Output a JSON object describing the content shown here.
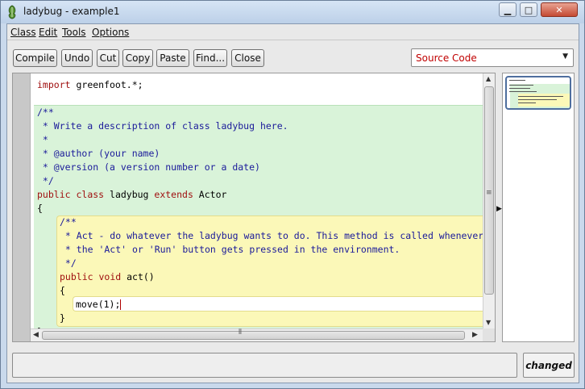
{
  "window": {
    "title": "ladybug - example1"
  },
  "menubar": {
    "items": [
      {
        "label": "Class"
      },
      {
        "label": "Edit"
      },
      {
        "label": "Tools"
      },
      {
        "label": "Options"
      }
    ]
  },
  "toolbar": {
    "buttons": [
      {
        "label": "Compile"
      },
      {
        "label": "Undo"
      },
      {
        "label": "Cut"
      },
      {
        "label": "Copy"
      },
      {
        "label": "Paste"
      },
      {
        "label": "Find..."
      },
      {
        "label": "Close"
      }
    ],
    "view_select": {
      "selected": "Source Code"
    }
  },
  "editor": {
    "lines": [
      {
        "parts": [
          {
            "t": "import ",
            "c": "kw"
          },
          {
            "t": "greenfoot.*;",
            "c": "tx"
          }
        ]
      },
      {
        "parts": [
          {
            "t": "/**",
            "c": "cm"
          }
        ]
      },
      {
        "parts": [
          {
            "t": " * Write a description of class ladybug here.",
            "c": "cm"
          }
        ]
      },
      {
        "parts": [
          {
            "t": " *",
            "c": "cm"
          }
        ]
      },
      {
        "parts": [
          {
            "t": " * @author (your name)",
            "c": "cm"
          }
        ]
      },
      {
        "parts": [
          {
            "t": " * @version (a version number or a date)",
            "c": "cm"
          }
        ]
      },
      {
        "parts": [
          {
            "t": " */",
            "c": "cm"
          }
        ]
      },
      {
        "parts": [
          {
            "t": "public ",
            "c": "kw"
          },
          {
            "t": "class ",
            "c": "kw"
          },
          {
            "t": "ladybug ",
            "c": "tx"
          },
          {
            "t": "extends ",
            "c": "kw"
          },
          {
            "t": "Actor",
            "c": "tx"
          }
        ]
      },
      {
        "parts": [
          {
            "t": "{",
            "c": "tx"
          }
        ]
      },
      {
        "parts": [
          {
            "t": "/**",
            "c": "cm"
          }
        ]
      },
      {
        "parts": [
          {
            "t": " * Act - do whatever the ladybug wants to do. This method is called whenever",
            "c": "cm"
          }
        ]
      },
      {
        "parts": [
          {
            "t": " * the 'Act' or 'Run' button gets pressed in the environment.",
            "c": "cm"
          }
        ]
      },
      {
        "parts": [
          {
            "t": " */",
            "c": "cm"
          }
        ]
      },
      {
        "parts": [
          {
            "t": "public ",
            "c": "kw"
          },
          {
            "t": "void ",
            "c": "kw"
          },
          {
            "t": "act()",
            "c": "tx"
          }
        ]
      },
      {
        "parts": [
          {
            "t": "{",
            "c": "tx"
          }
        ]
      },
      {
        "parts": [
          {
            "t": "move(1);",
            "c": "tx"
          }
        ]
      },
      {
        "parts": [
          {
            "t": "}",
            "c": "tx"
          }
        ]
      },
      {
        "parts": [
          {
            "t": "}",
            "c": "tx"
          }
        ]
      }
    ]
  },
  "status": {
    "message": "",
    "state": "changed"
  }
}
